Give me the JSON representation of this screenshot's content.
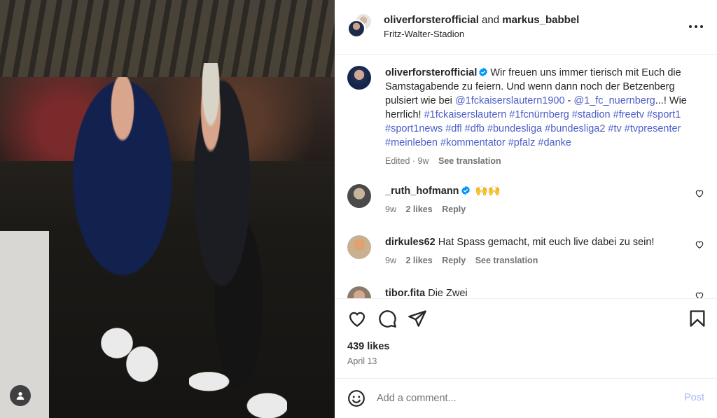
{
  "header": {
    "user1": "oliverforsterofficial",
    "connector": "and",
    "user2": "markus_babbel",
    "location": "Fritz-Walter-Stadion"
  },
  "caption": {
    "username": "oliverforsterofficial",
    "text_part1": "Wir freuen uns immer tierisch mit Euch die Samstagabende zu feiern. Und wenn dann noch der Betzenberg pulsiert wie bei ",
    "mention1": "@1fckaiserslautern1900",
    "sep": " - ",
    "mention2": "@1_fc_nuernberg",
    "text_part2": "...! Wie herrlich! ",
    "hashtags": "#1fckaiserslautern #1fcnürnberg #stadion #freetv #sport1 #sport1news #dfl #dfb #bundesliga #bundesliga2 #tv #tvpresenter #meinleben #kommentator #pfalz #danke",
    "edited": "Edited · 9w",
    "see_translation": "See translation"
  },
  "comments": [
    {
      "username": "_ruth_hofmann",
      "text": "🙌🙌",
      "age": "9w",
      "likes": "2 likes",
      "reply": "Reply",
      "verified": true
    },
    {
      "username": "dirkules62",
      "text": "Hat Spass gemacht, mit euch live dabei zu sein!",
      "age": "9w",
      "likes": "2 likes",
      "reply": "Reply",
      "see_translation": "See translation"
    },
    {
      "username": "tibor.fita",
      "text": "Die Zwei"
    }
  ],
  "actions": {
    "likes": "439 likes",
    "date": "April 13"
  },
  "add_comment": {
    "placeholder": "Add a comment...",
    "post_label": "Post"
  },
  "icons": {
    "like": "heart-icon",
    "comment": "comment-icon",
    "share": "send-icon",
    "save": "bookmark-icon",
    "more": "more-icon",
    "emoji": "emoji-icon",
    "tagged_user": "user-tag-icon"
  },
  "colors": {
    "link": "#4d5fc9",
    "verified": "#0095f6",
    "post_disabled": "#a9b9f7"
  }
}
